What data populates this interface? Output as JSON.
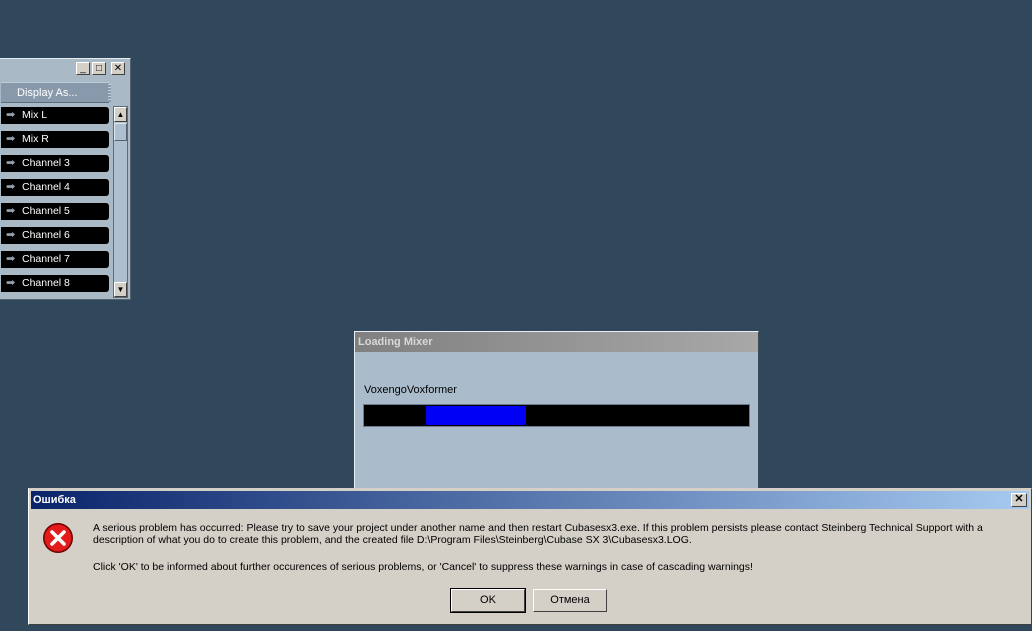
{
  "connections_panel": {
    "minimize_glyph": "_",
    "maximize_glyph": "□",
    "close_glyph": "✕",
    "display_as_label": "Display As...",
    "arrow_glyph": "➡",
    "channels": [
      {
        "label": "Mix L"
      },
      {
        "label": "Mix R"
      },
      {
        "label": "Channel 3"
      },
      {
        "label": "Channel 4"
      },
      {
        "label": "Channel 5"
      },
      {
        "label": "Channel 6"
      },
      {
        "label": "Channel 7"
      },
      {
        "label": "Channel 8"
      }
    ],
    "scroll_up_glyph": "▲",
    "scroll_down_glyph": "▼"
  },
  "loading_window": {
    "title": "Loading Mixer",
    "current_item": "VoxengoVoxformer",
    "progress_segment": {
      "start": 0.16,
      "end": 0.42
    },
    "progress_color": "#0000f4"
  },
  "error_dialog": {
    "title": "Ошибка",
    "close_glyph": "✕",
    "icon": "error-icon",
    "message": "A serious problem has occurred: Please try to save your project under another name and then restart Cubasesx3.exe. If this problem persists please contact Steinberg Technical Support with a description of what you do to create this problem, and the created file D:\\Program Files\\Steinberg\\Cubase SX 3\\Cubasesx3.LOG.",
    "message2": "Click 'OK' to be informed about further occurences of serious problems, or 'Cancel' to suppress these warnings in case of cascading warnings!",
    "ok_label": "OK",
    "cancel_label": "Отмена"
  }
}
